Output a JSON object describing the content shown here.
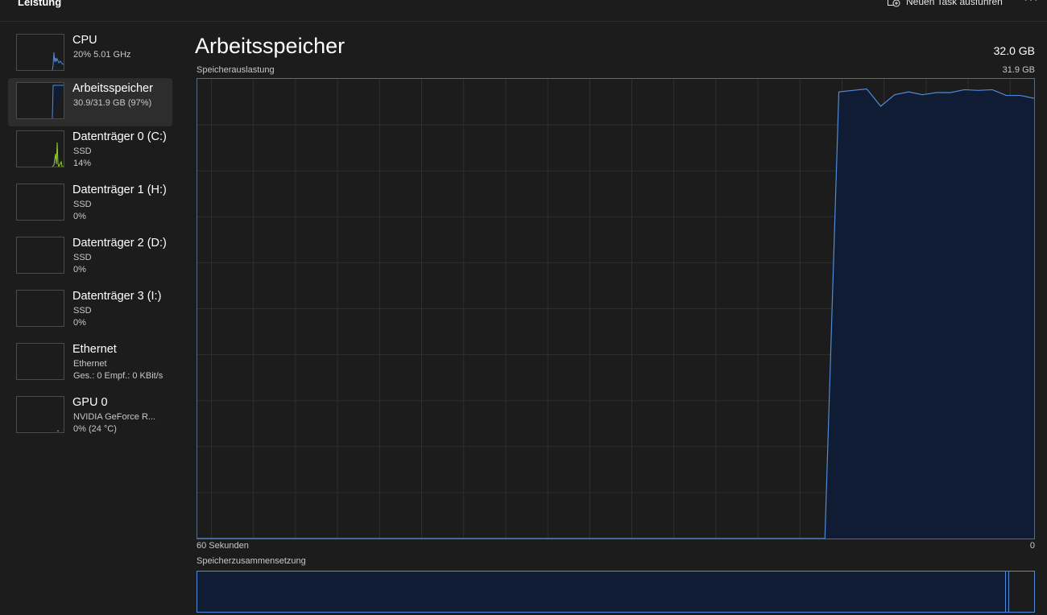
{
  "topbar": {
    "title": "Leistung",
    "new_task_label": "Neuen Task ausführen",
    "more_label": "···"
  },
  "sidebar": {
    "items": [
      {
        "name": "CPU",
        "line1": "20%  5.01 GHz",
        "line2": "",
        "icon": "cpu-graph",
        "color": "#4f8ad8"
      },
      {
        "name": "Arbeitsspeicher",
        "line1": "30.9/31.9 GB (97%)",
        "line2": "",
        "icon": "memory-graph",
        "color": "#4f8ad8"
      },
      {
        "name": "Datenträger 0 (C:)",
        "line1": "SSD",
        "line2": "14%",
        "icon": "disk-graph",
        "color": "#8fcf2b"
      },
      {
        "name": "Datenträger 1 (H:)",
        "line1": "SSD",
        "line2": "0%",
        "icon": "disk-graph",
        "color": "#8fcf2b"
      },
      {
        "name": "Datenträger 2 (D:)",
        "line1": "SSD",
        "line2": "0%",
        "icon": "disk-graph",
        "color": "#8fcf2b"
      },
      {
        "name": "Datenträger 3 (I:)",
        "line1": "SSD",
        "line2": "0%",
        "icon": "disk-graph",
        "color": "#8fcf2b"
      },
      {
        "name": "Ethernet",
        "line1": "Ethernet",
        "line2": "Ges.: 0 Empf.: 0 KBit/s",
        "icon": "network-graph",
        "color": "#d07bd0"
      },
      {
        "name": "GPU 0",
        "line1": "NVIDIA GeForce R...",
        "line2": "0%  (24 °C)",
        "icon": "gpu-graph",
        "color": "#4f8ad8"
      }
    ]
  },
  "main": {
    "title": "Arbeitsspeicher",
    "capacity": "32.0 GB",
    "usage_label": "Speicherauslastung",
    "usage_max": "31.9 GB",
    "x_left_label": "60 Sekunden",
    "x_right_label": "0",
    "composition_label": "Speicherzusammensetzung"
  },
  "colors": {
    "accent": "#4f8ad8",
    "fill": "#0f1c33",
    "grid": "#2f2f2f",
    "disk": "#8fcf2b"
  },
  "chart_data": {
    "type": "area",
    "title": "Speicherauslastung",
    "xlabel": "",
    "ylabel": "",
    "xlim": [
      60,
      0
    ],
    "ylim": [
      0,
      31.9
    ],
    "grid": true,
    "x": [
      60,
      15,
      14,
      13,
      12,
      11,
      10,
      9,
      8,
      7,
      6,
      5,
      4,
      3,
      2,
      1,
      0
    ],
    "series": [
      {
        "values": [
          0,
          0,
          31.0,
          31.1,
          31.2,
          30.0,
          30.8,
          31.0,
          30.8,
          30.95,
          30.95,
          31.15,
          31.1,
          31.15,
          30.75,
          30.75,
          30.55
        ]
      }
    ]
  }
}
